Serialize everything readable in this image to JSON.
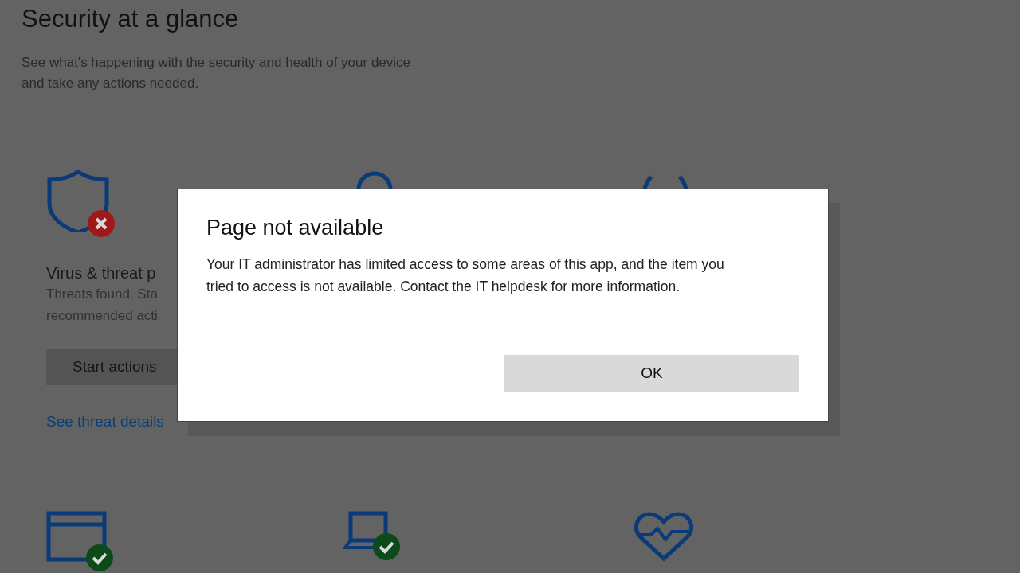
{
  "page": {
    "title": "Security at a glance",
    "subtitle_lines": [
      "See what's happening with the security and health of your device",
      "and take any actions needed."
    ]
  },
  "cards_row_1": [
    {
      "kind": "shield",
      "threats": true,
      "protected": false,
      "title": "Virus & threat p",
      "description_lines": [
        "Threats found. Sta",
        "recommended acti"
      ],
      "button": "Start actions",
      "link": "See threat details"
    },
    {
      "kind": "person"
    },
    {
      "kind": "antenna"
    }
  ],
  "cards_row_2": [
    {
      "kind": "browser",
      "threats": false,
      "protected": true
    },
    {
      "kind": "laptop",
      "threats": false,
      "protected": true
    },
    {
      "kind": "heart",
      "threats": false,
      "protected": false
    }
  ],
  "dialog": {
    "title": "Page not available",
    "message": "Your IT administrator has limited access to some areas of this app, and the item you tried to access is not available. Contact the IT helpdesk for more information.",
    "buttons": [
      "OK"
    ]
  }
}
